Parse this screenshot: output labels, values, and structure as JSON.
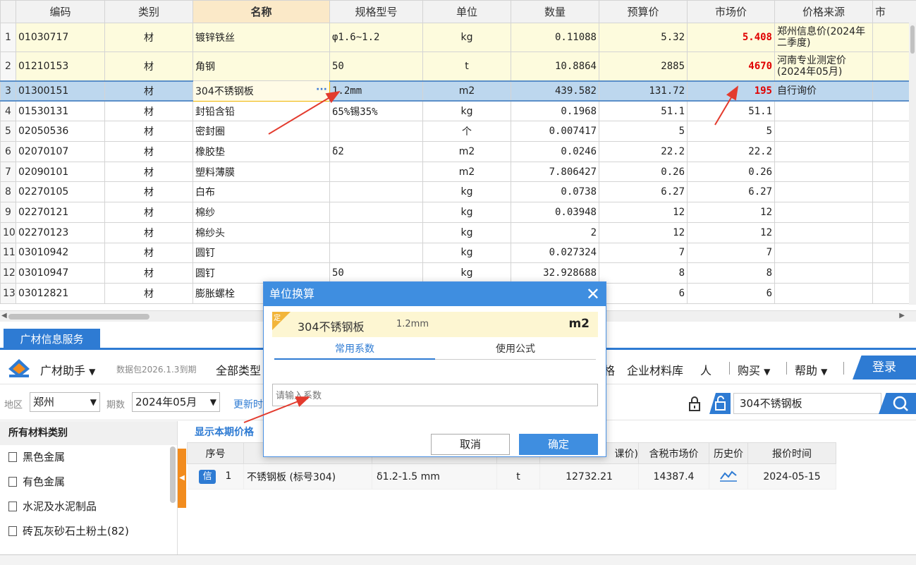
{
  "grid": {
    "columns": [
      "编码",
      "类别",
      "名称",
      "规格型号",
      "单位",
      "数量",
      "预算价",
      "市场价",
      "价格来源",
      "市"
    ],
    "rows": [
      {
        "n": "1",
        "code": "01030717",
        "type": "材",
        "name": "镀锌铁丝",
        "spec": "φ1.6~1.2",
        "unit": "kg",
        "qty": "0.11088",
        "budget": "5.32",
        "market": "5.408",
        "source": "郑州信息价(2024年二季度)"
      },
      {
        "n": "2",
        "code": "01210153",
        "type": "材",
        "name": "角钢",
        "spec": "50",
        "unit": "t",
        "qty": "10.8864",
        "budget": "2885",
        "market": "4670",
        "source": "河南专业测定价(2024年05月)"
      },
      {
        "n": "3",
        "code": "01300151",
        "type": "材",
        "name": "304不锈钢板",
        "spec": "1.2mm",
        "unit": "m2",
        "qty": "439.582",
        "budget": "131.72",
        "market": "195",
        "source": "自行询价"
      },
      {
        "n": "4",
        "code": "01530131",
        "type": "材",
        "name": "封铅含铅",
        "spec": "65%锡35%",
        "unit": "kg",
        "qty": "0.1968",
        "budget": "51.1",
        "market": "51.1",
        "source": ""
      },
      {
        "n": "5",
        "code": "02050536",
        "type": "材",
        "name": "密封圈",
        "spec": "",
        "unit": "个",
        "qty": "0.007417",
        "budget": "5",
        "market": "5",
        "source": ""
      },
      {
        "n": "6",
        "code": "02070107",
        "type": "材",
        "name": "橡胶垫",
        "spec": "δ2",
        "unit": "m2",
        "qty": "0.0246",
        "budget": "22.2",
        "market": "22.2",
        "source": ""
      },
      {
        "n": "7",
        "code": "02090101",
        "type": "材",
        "name": "塑料薄膜",
        "spec": "",
        "unit": "m2",
        "qty": "7.806427",
        "budget": "0.26",
        "market": "0.26",
        "source": ""
      },
      {
        "n": "8",
        "code": "02270105",
        "type": "材",
        "name": "白布",
        "spec": "",
        "unit": "kg",
        "qty": "0.0738",
        "budget": "6.27",
        "market": "6.27",
        "source": ""
      },
      {
        "n": "9",
        "code": "02270121",
        "type": "材",
        "name": "棉纱",
        "spec": "",
        "unit": "kg",
        "qty": "0.03948",
        "budget": "12",
        "market": "12",
        "source": ""
      },
      {
        "n": "10",
        "code": "02270123",
        "type": "材",
        "name": "棉纱头",
        "spec": "",
        "unit": "kg",
        "qty": "2",
        "budget": "12",
        "market": "12",
        "source": ""
      },
      {
        "n": "11",
        "code": "03010942",
        "type": "材",
        "name": "圆钉",
        "spec": "",
        "unit": "kg",
        "qty": "0.027324",
        "budget": "7",
        "market": "7",
        "source": ""
      },
      {
        "n": "12",
        "code": "03010947",
        "type": "材",
        "name": "圆钉",
        "spec": "50",
        "unit": "kg",
        "qty": "32.928688",
        "budget": "8",
        "market": "8",
        "source": ""
      },
      {
        "n": "13",
        "code": "03012821",
        "type": "材",
        "name": "膨胀螺栓",
        "spec": "",
        "unit": "",
        "qty": "",
        "budget": "6",
        "market": "6",
        "source": ""
      }
    ],
    "ellipsis": "···"
  },
  "lower": {
    "tab": "广材信息服务",
    "assistant": "广材助手",
    "package": "数据包2026.1.3到期",
    "all_types": "全部类型",
    "grid_price": "格",
    "corp_lib": "企业材料库",
    "person": "人",
    "buy": "购买",
    "help": "帮助",
    "login": "登录",
    "region_label": "地区",
    "region": "郑州",
    "period_label": "期数",
    "period": "2024年05月",
    "update": "更新时",
    "search_value": "304不锈钢板",
    "side_head": "所有材料类别",
    "categories": [
      "黑色金属",
      "有色金属",
      "水泥及水泥制品",
      "砖瓦灰砂石土粉土(82)"
    ],
    "show_period": "显示本期价格",
    "result_headers": [
      "序号",
      "",
      "",
      "",
      "课价)",
      "含税市场价",
      "历史价",
      "报价时间"
    ],
    "result_row": {
      "badge": "信",
      "no": "1",
      "name": "不锈钢板 (标号304)",
      "spec": "δ1.2-1.5 mm",
      "unit": "t",
      "price": "12732.21",
      "market": "14387.4",
      "date": "2024-05-15"
    }
  },
  "modal": {
    "title": "单位换算",
    "badge": "定",
    "name": "304不锈钢板",
    "spec": "1.2mm",
    "unit": "m2",
    "tab_common": "常用系数",
    "tab_formula": "使用公式",
    "placeholder": "请输入系数",
    "cancel": "取消",
    "ok": "确定"
  },
  "colors": {
    "accent": "#2e7bd3",
    "red": "#e00000",
    "orange": "#f28c1e"
  }
}
